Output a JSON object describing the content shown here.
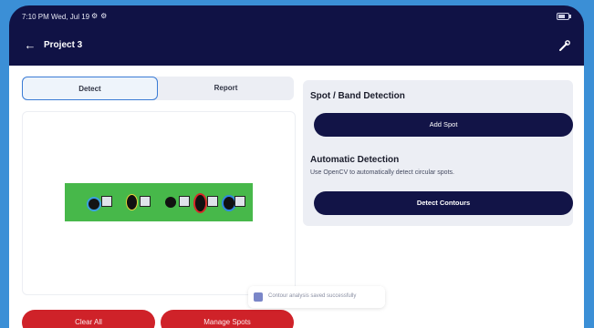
{
  "status": {
    "time": "7:10 PM Wed, Jul 19",
    "icons": [
      "settings-icon",
      "settings-icon"
    ],
    "battery_icon": "battery-icon"
  },
  "appbar": {
    "title": "Project 3",
    "back_icon": "arrow-left-icon",
    "tool_icon": "wrench-icon"
  },
  "tabs": [
    {
      "label": "Detect",
      "selected": true
    },
    {
      "label": "Report",
      "selected": false
    }
  ],
  "buttons": {
    "clear_all": "Clear All",
    "manage_spots": "Manage Spots"
  },
  "toast": {
    "text": "Contour analysis saved successfully"
  },
  "spot_detection": {
    "title": "Spot / Band Detection",
    "add_spot": "Add Spot"
  },
  "auto_detection": {
    "title": "Automatic Detection",
    "description": "Use OpenCV to automatically detect circular spots.",
    "detect_contours": "Detect Contours"
  },
  "colors": {
    "navy": "#121447",
    "red": "#cf2229",
    "green": "#47b84a",
    "accent": "#3a7bd5"
  }
}
